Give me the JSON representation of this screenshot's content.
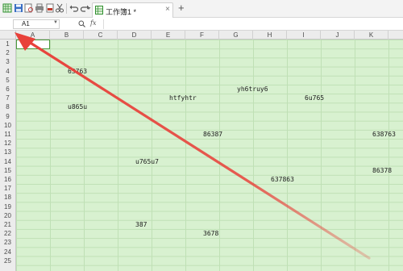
{
  "toolbar": {
    "icons": [
      "spreadsheet-icon",
      "save-icon",
      "print-preview-icon",
      "print-icon",
      "pdf-icon",
      "scissors-icon",
      "undo-icon",
      "redo-icon",
      "dropdown-icon"
    ],
    "tab": {
      "label": "工作簿1 *",
      "close": "×"
    },
    "new_tab": "+"
  },
  "formula_bar": {
    "cell_ref": "A1",
    "fx": "fx",
    "formula": ""
  },
  "columns": [
    "A",
    "B",
    "C",
    "D",
    "E",
    "F",
    "G",
    "H",
    "I",
    "J",
    "K"
  ],
  "rows": [
    "1",
    "2",
    "3",
    "4",
    "5",
    "6",
    "7",
    "8",
    "9",
    "10",
    "11",
    "12",
    "13",
    "14",
    "15",
    "16",
    "17",
    "18",
    "19",
    "20",
    "21",
    "22",
    "23",
    "24",
    "25"
  ],
  "cells": [
    {
      "ref": "B4",
      "value": "63763"
    },
    {
      "ref": "G6",
      "value": "yh6truy6"
    },
    {
      "ref": "E7",
      "value": "htfyhtr"
    },
    {
      "ref": "I7",
      "value": "6u765"
    },
    {
      "ref": "B8",
      "value": "u865u"
    },
    {
      "ref": "F11",
      "value": "86387"
    },
    {
      "ref": "K11",
      "value": "638763"
    },
    {
      "ref": "D14",
      "value": "u765u7"
    },
    {
      "ref": "K15",
      "value": "86378"
    },
    {
      "ref": "H16",
      "value": "637863"
    },
    {
      "ref": "D21",
      "value": "387"
    },
    {
      "ref": "F22",
      "value": "3678"
    }
  ],
  "annotation": {
    "color": "#e8413a"
  },
  "colors": {
    "grid_fill": "#d8f1d0",
    "header_bg": "#ececec",
    "active_border": "#4a9a3a"
  }
}
